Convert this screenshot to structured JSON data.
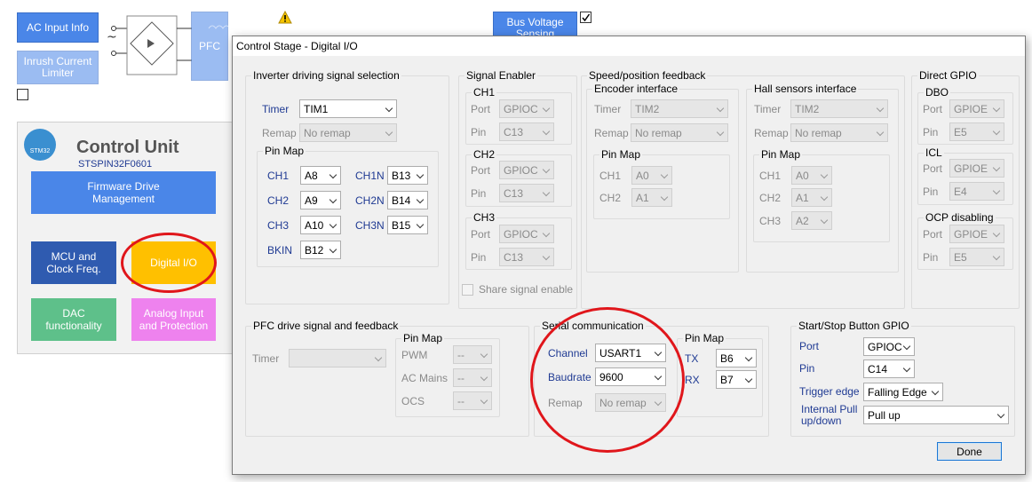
{
  "background": {
    "ac_input_label": "AC Input Info",
    "inrush_label": "Inrush Current Limiter",
    "pfc_label": "PFC",
    "bus_voltage_label": "Bus Voltage Sensing",
    "control_unit": {
      "title": "Control Unit",
      "part": "STSPIN32F0601",
      "logo_text": "STM32",
      "firmware_label": "Firmware Drive Management",
      "mcu_label": "MCU and Clock Freq.",
      "digital_io_label": "Digital I/O",
      "dac_label": "DAC functionality",
      "analog_label": "Analog Input and Protection"
    }
  },
  "dialog": {
    "title": "Control Stage - Digital I/O",
    "inverter": {
      "legend": "Inverter driving signal selection",
      "timer_label": "Timer",
      "timer_value": "TIM1",
      "remap_label": "Remap",
      "remap_value": "No remap",
      "pinmap_legend": "Pin Map",
      "pins": [
        {
          "label": "CH1",
          "value": "A8"
        },
        {
          "label": "CH1N",
          "value": "B13"
        },
        {
          "label": "CH2",
          "value": "A9"
        },
        {
          "label": "CH2N",
          "value": "B14"
        },
        {
          "label": "CH3",
          "value": "A10"
        },
        {
          "label": "CH3N",
          "value": "B15"
        },
        {
          "label": "BKIN",
          "value": "B12"
        }
      ]
    },
    "signal_enabler": {
      "legend": "Signal Enabler",
      "groups": [
        {
          "legend": "CH1",
          "port_label": "Port",
          "port_value": "GPIOC",
          "pin_label": "Pin",
          "pin_value": "C13"
        },
        {
          "legend": "CH2",
          "port_label": "Port",
          "port_value": "GPIOC",
          "pin_label": "Pin",
          "pin_value": "C13"
        },
        {
          "legend": "CH3",
          "port_label": "Port",
          "port_value": "GPIOC",
          "pin_label": "Pin",
          "pin_value": "C13"
        }
      ],
      "share_label": "Share signal enable"
    },
    "speed": {
      "legend": "Speed/position feedback",
      "encoder": {
        "legend": "Encoder interface",
        "timer_label": "Timer",
        "timer_value": "TIM2",
        "remap_label": "Remap",
        "remap_value": "No remap",
        "pinmap_legend": "Pin Map",
        "pins": [
          {
            "label": "CH1",
            "value": "A0"
          },
          {
            "label": "CH2",
            "value": "A1"
          }
        ]
      },
      "hall": {
        "legend": "Hall sensors interface",
        "timer_label": "Timer",
        "timer_value": "TIM2",
        "remap_label": "Remap",
        "remap_value": "No remap",
        "pinmap_legend": "Pin Map",
        "pins": [
          {
            "label": "CH1",
            "value": "A0"
          },
          {
            "label": "CH2",
            "value": "A1"
          },
          {
            "label": "CH3",
            "value": "A2"
          }
        ]
      }
    },
    "direct_gpio": {
      "legend": "Direct GPIO",
      "groups": [
        {
          "legend": "DBO",
          "port_label": "Port",
          "port_value": "GPIOE",
          "pin_label": "Pin",
          "pin_value": "E5"
        },
        {
          "legend": "ICL",
          "port_label": "Port",
          "port_value": "GPIOE",
          "pin_label": "Pin",
          "pin_value": "E4"
        },
        {
          "legend": "OCP disabling",
          "port_label": "Port",
          "port_value": "GPIOE",
          "pin_label": "Pin",
          "pin_value": "E5"
        }
      ]
    },
    "pfc": {
      "legend": "PFC drive signal and feedback",
      "timer_label": "Timer",
      "timer_value": "",
      "pinmap_legend": "Pin Map",
      "pins": [
        {
          "label": "PWM",
          "value": "--"
        },
        {
          "label": "AC Mains",
          "value": "--"
        },
        {
          "label": "OCS",
          "value": "--"
        }
      ]
    },
    "serial": {
      "legend": "Serial communication",
      "channel_label": "Channel",
      "channel_value": "USART1",
      "baudrate_label": "Baudrate",
      "baudrate_value": "9600",
      "remap_label": "Remap",
      "remap_value": "No remap",
      "pinmap_legend": "Pin Map",
      "tx_label": "TX",
      "tx_value": "B6",
      "rx_label": "RX",
      "rx_value": "B7"
    },
    "startstop": {
      "legend": "Start/Stop Button GPIO",
      "port_label": "Port",
      "port_value": "GPIOC",
      "pin_label": "Pin",
      "pin_value": "C14",
      "trigger_label": "Trigger edge",
      "trigger_value": "Falling Edge",
      "pull_label": "Internal Pull up/down",
      "pull_value": "Pull up"
    },
    "done_label": "Done"
  },
  "colors": {
    "accent_blue": "#4a86e8",
    "highlight_red": "#e0161b",
    "digital_io_yellow": "#ffc000"
  }
}
